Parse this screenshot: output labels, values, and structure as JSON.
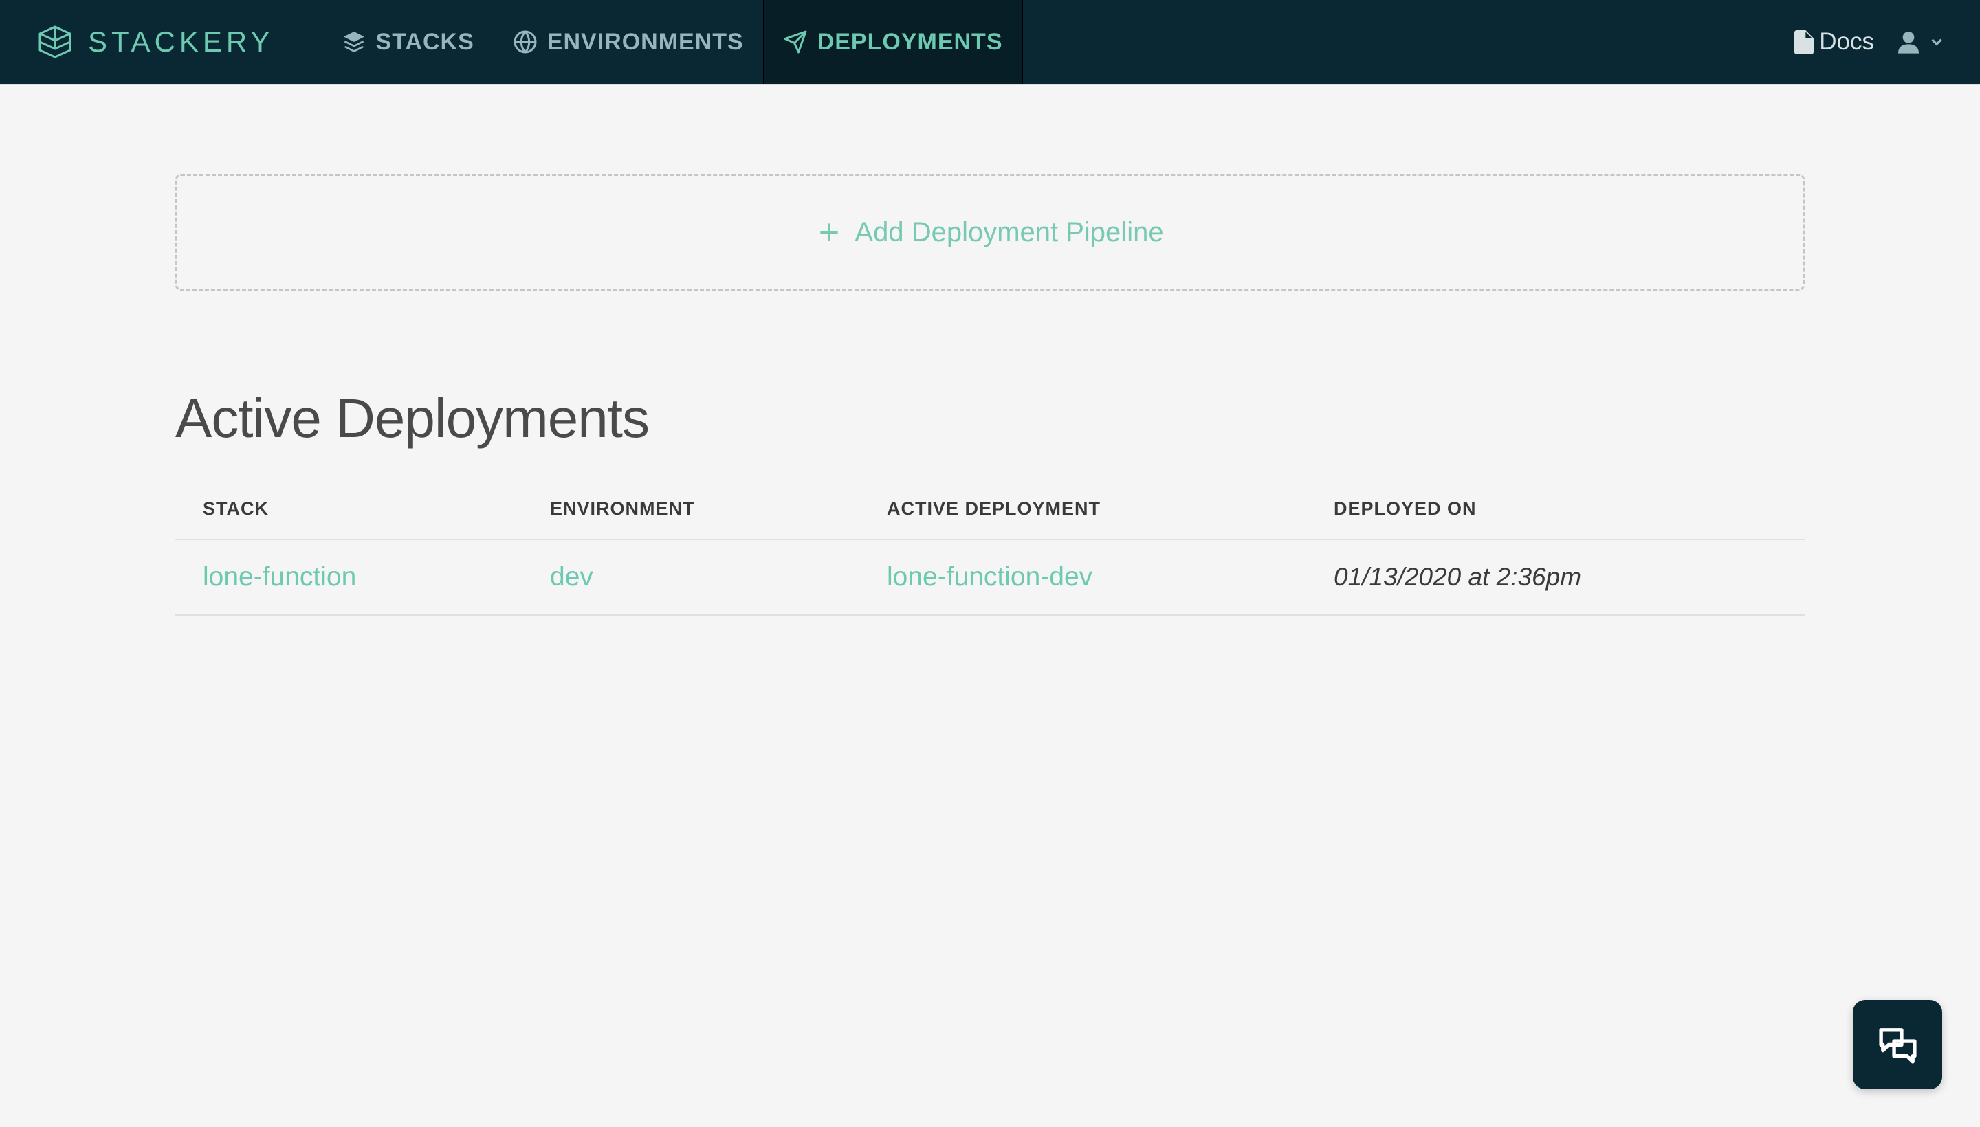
{
  "header": {
    "logo_text": "STACKERY",
    "nav": [
      {
        "label": "STACKS",
        "icon": "layers-icon",
        "active": false
      },
      {
        "label": "ENVIRONMENTS",
        "icon": "globe-icon",
        "active": false
      },
      {
        "label": "DEPLOYMENTS",
        "icon": "paper-plane-icon",
        "active": true
      }
    ],
    "docs_label": "Docs"
  },
  "add_pipeline": {
    "label": "Add Deployment Pipeline"
  },
  "page_title": "Active Deployments",
  "table": {
    "headers": {
      "stack": "STACK",
      "environment": "ENVIRONMENT",
      "active_deployment": "ACTIVE DEPLOYMENT",
      "deployed_on": "DEPLOYED ON"
    },
    "rows": [
      {
        "stack": "lone-function",
        "environment": "dev",
        "active_deployment": "lone-function-dev",
        "deployed_on": "01/13/2020 at 2:36pm"
      }
    ]
  },
  "colors": {
    "accent": "#6dc9b0",
    "header_bg": "#0a2833"
  }
}
